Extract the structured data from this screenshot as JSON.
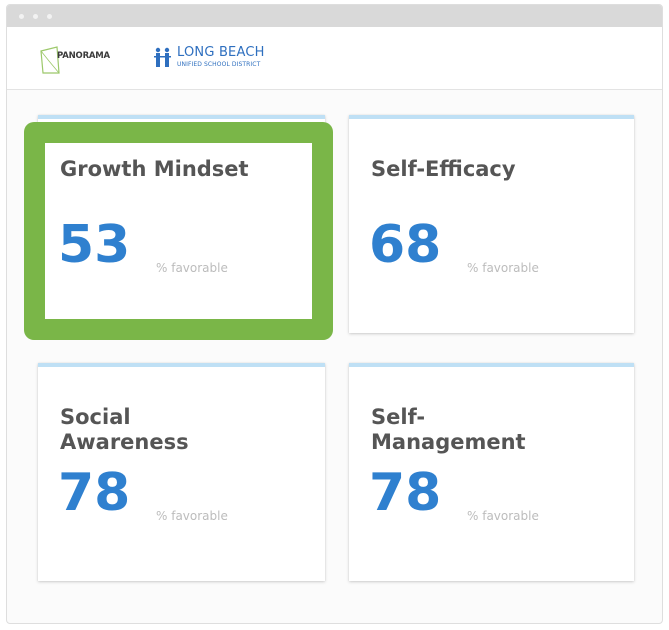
{
  "header": {
    "panorama_logo": "PANORAMA",
    "district_name": "LONG BEACH",
    "district_subtitle": "UNIFIED SCHOOL DISTRICT"
  },
  "colors": {
    "value_blue": "#2f80cf",
    "highlight_green": "#7ab648",
    "card_accent": "#bfe0f5"
  },
  "cards": [
    {
      "title": "Growth Mindset",
      "value": "53",
      "unit": "% favorable",
      "highlighted": true
    },
    {
      "title": "Self-Efficacy",
      "value": "68",
      "unit": "% favorable",
      "highlighted": false
    },
    {
      "title": "Social Awareness",
      "value": "78",
      "unit": "% favorable",
      "highlighted": false
    },
    {
      "title": "Self-Management",
      "value": "78",
      "unit": "% favorable",
      "highlighted": false
    }
  ]
}
